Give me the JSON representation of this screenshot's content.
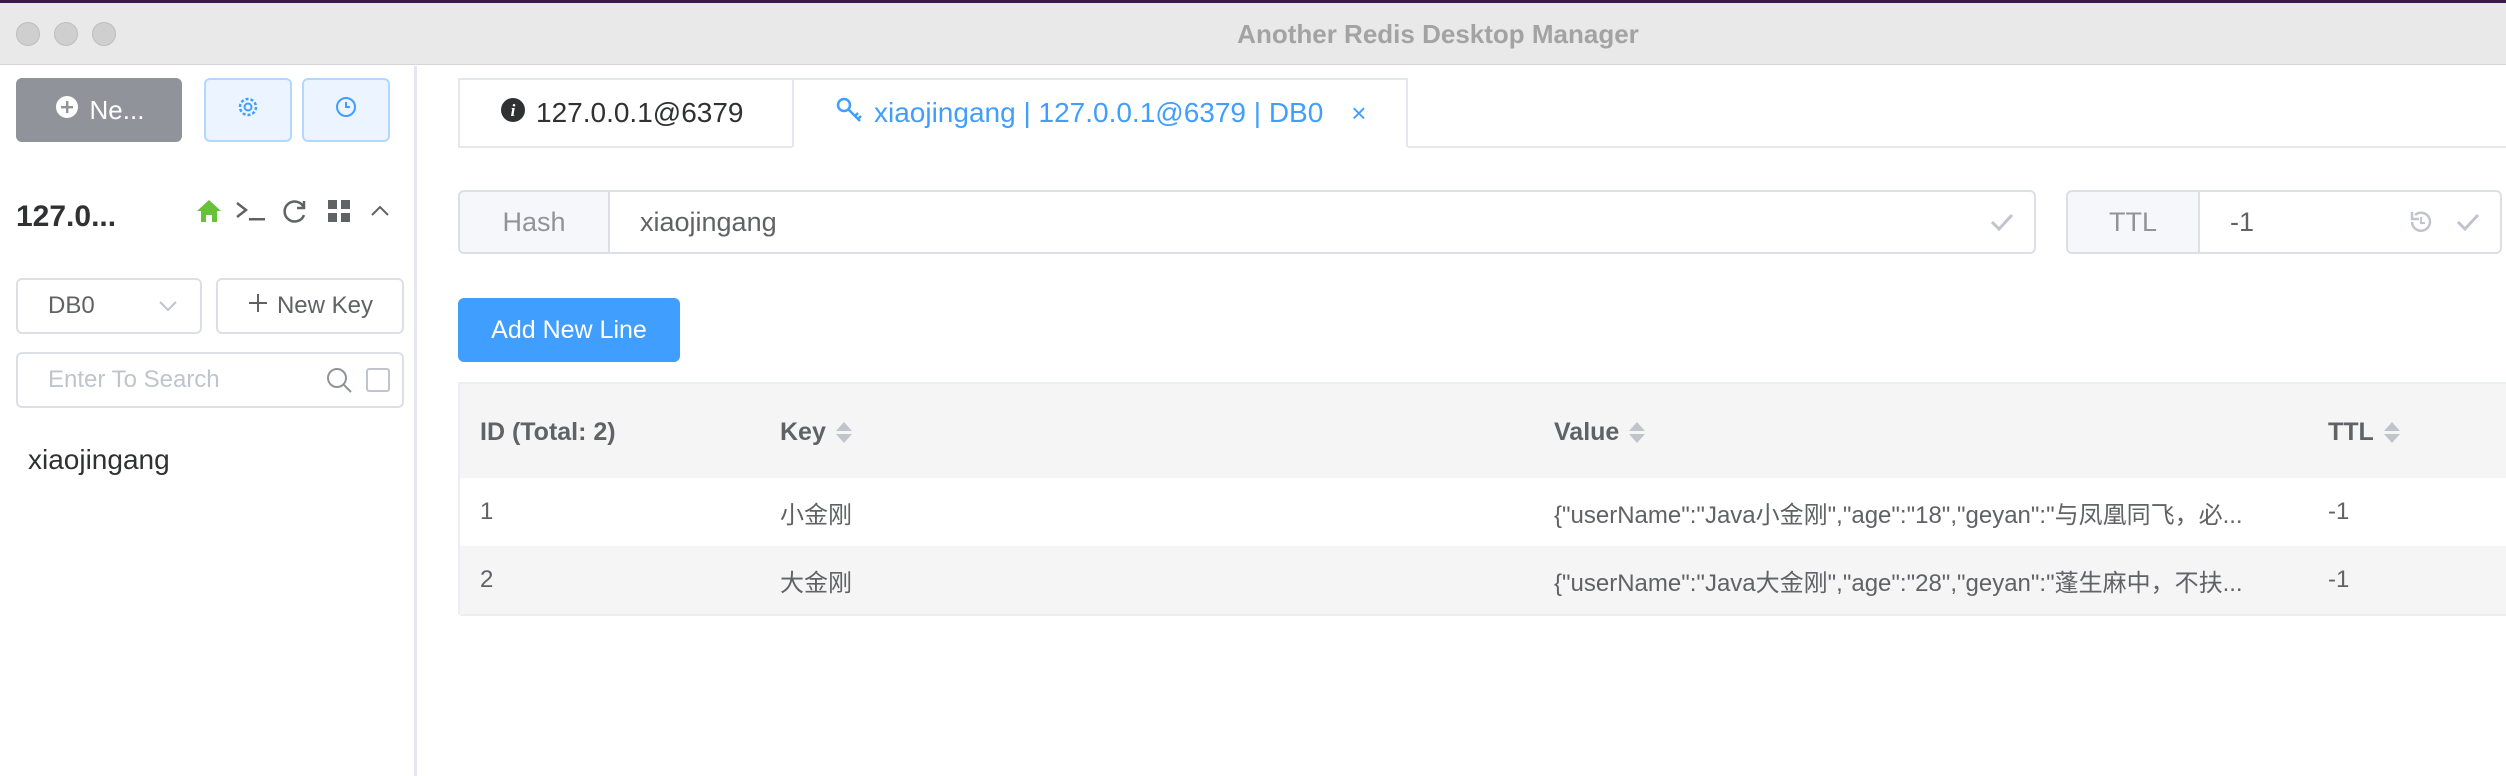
{
  "window": {
    "title": "Another Redis Desktop Manager"
  },
  "sidebar": {
    "new_connection_label": "Ne...",
    "connection_name": "127.0...",
    "db_select_value": "DB0",
    "new_key_label": "New Key",
    "search_placeholder": "Enter To Search",
    "keys": [
      "xiaojingang"
    ]
  },
  "tabs": [
    {
      "label": "127.0.0.1@6379",
      "icon": "info-icon",
      "active": false
    },
    {
      "label": "xiaojingang | 127.0.0.1@6379 | DB0",
      "icon": "key-icon",
      "active": true,
      "close": "×"
    }
  ],
  "key_editor": {
    "type_label": "Hash",
    "key_name": "xiaojingang",
    "ttl_label": "TTL",
    "ttl_value": "-1",
    "add_line_label": "Add New Line"
  },
  "table": {
    "columns": [
      "ID (Total: 2)",
      "Key",
      "Value",
      "TTL"
    ],
    "rows": [
      {
        "id": "1",
        "key": "小金刚",
        "value": "{\"userName\":\"Java小金刚\",\"age\":\"18\",\"geyan\":\"与凤凰同飞，必...",
        "ttl": "-1"
      },
      {
        "id": "2",
        "key": "大金刚",
        "value": "{\"userName\":\"Java大金刚\",\"age\":\"28\",\"geyan\":\"蓬生麻中，不扶...",
        "ttl": "-1"
      }
    ]
  },
  "colors": {
    "accent": "#409eff",
    "gray_button": "#909399",
    "border": "#dcdfe6"
  }
}
